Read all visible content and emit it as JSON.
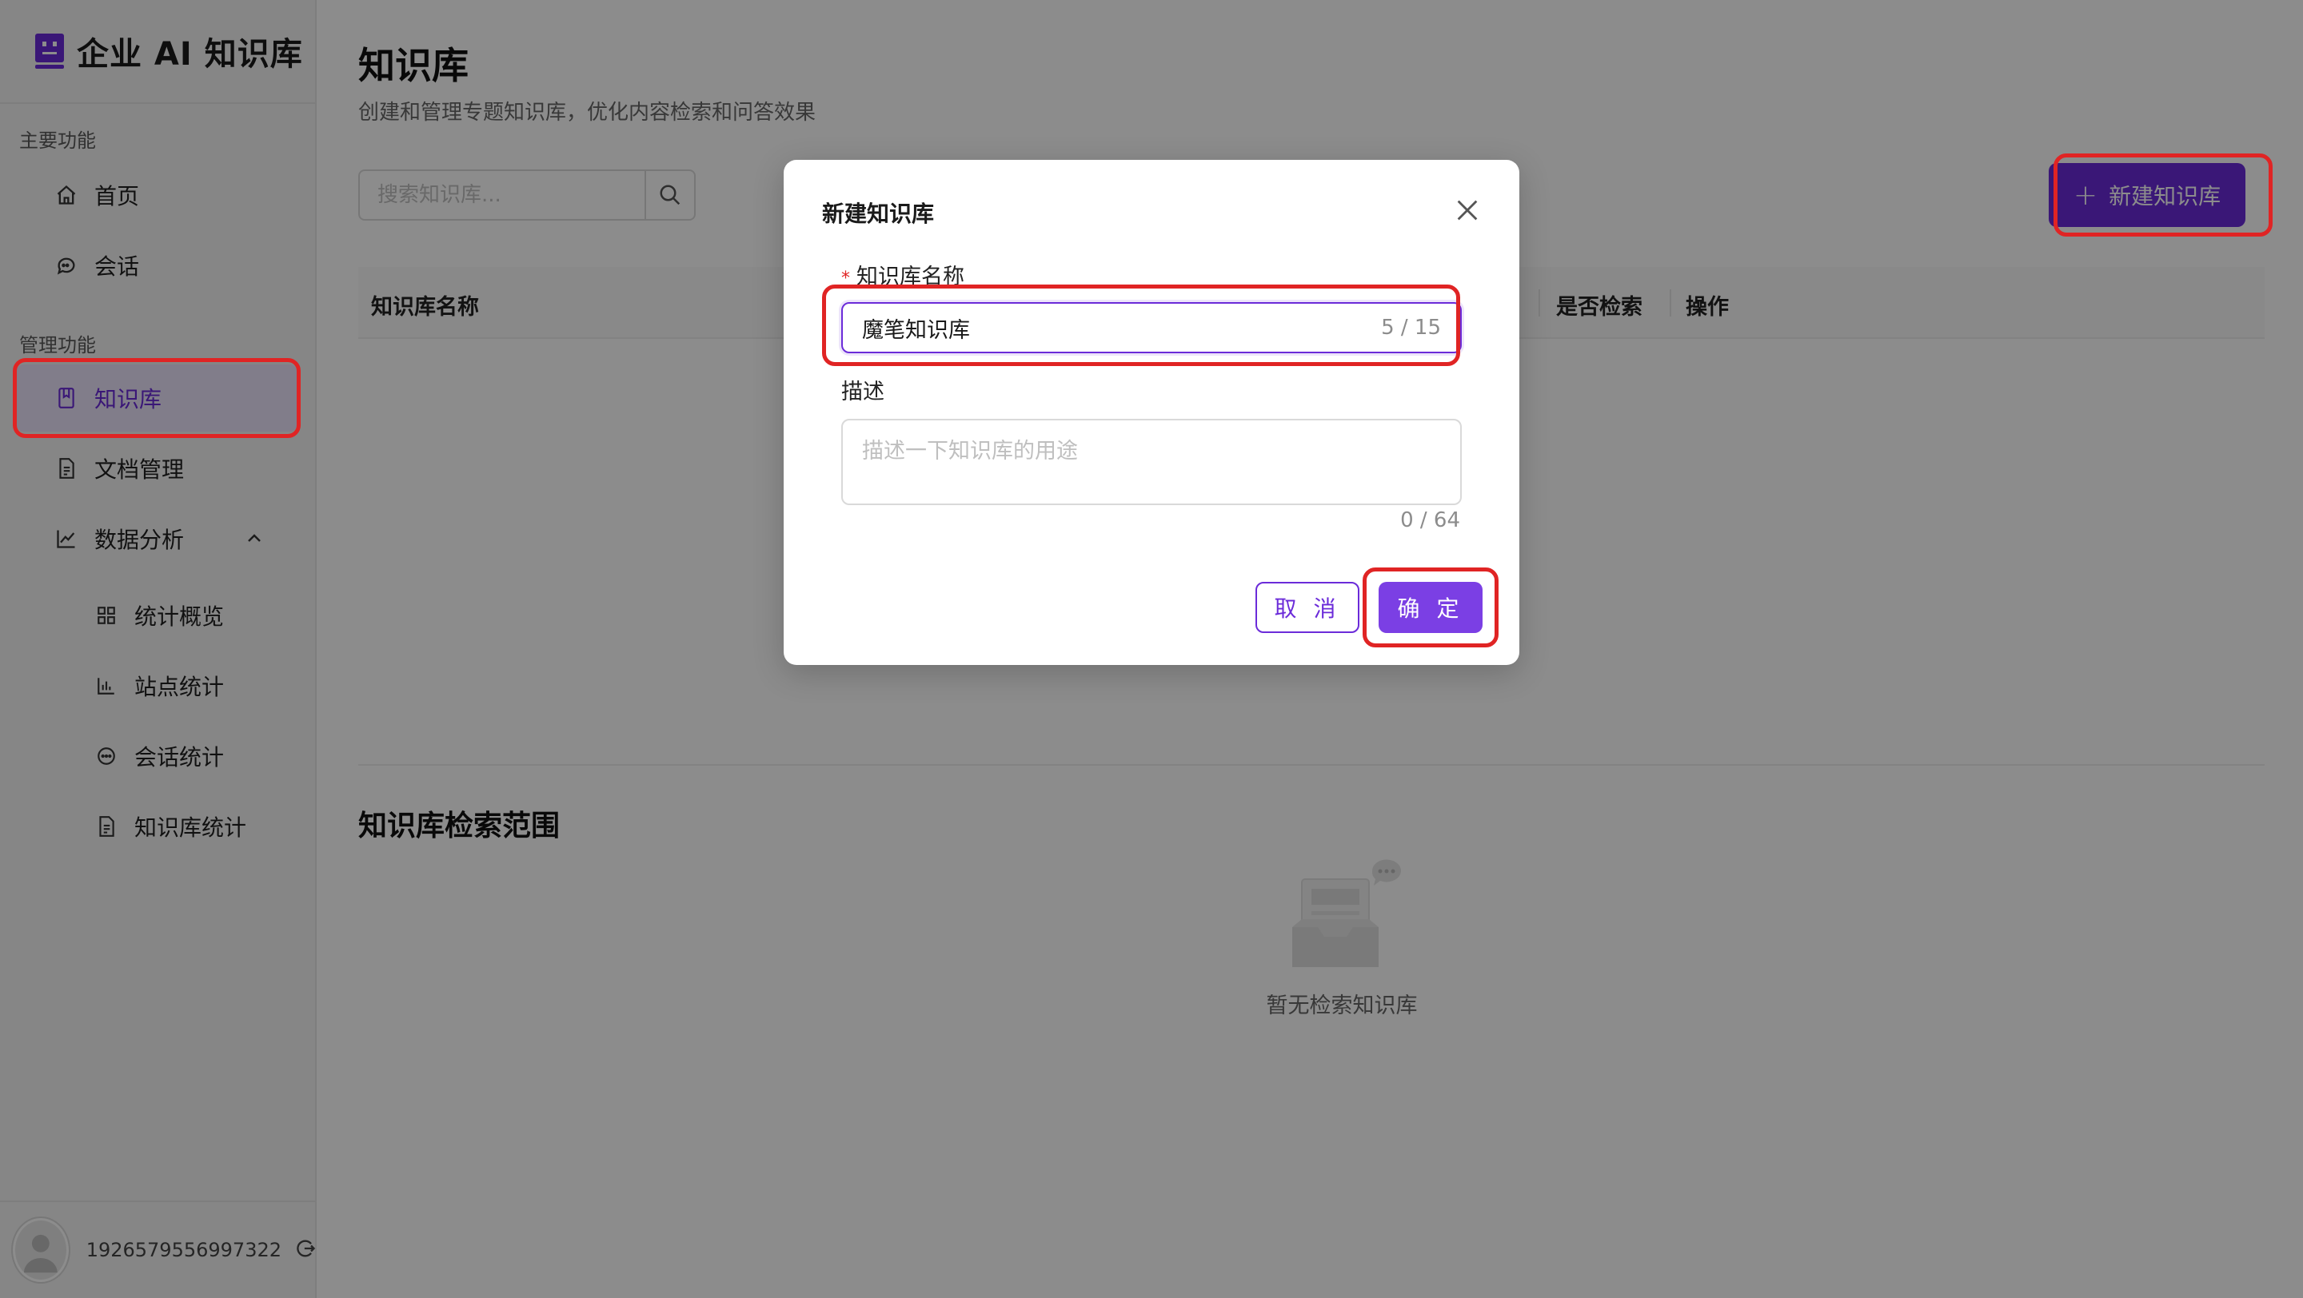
{
  "app": {
    "title": "企业 AI 知识库"
  },
  "sidebar": {
    "main_label": "主要功能",
    "admin_label": "管理功能",
    "items": [
      {
        "label": "首页",
        "icon": "home-icon"
      },
      {
        "label": "会话",
        "icon": "chat-icon"
      },
      {
        "label": "知识库",
        "icon": "book-icon",
        "active": true
      },
      {
        "label": "文档管理",
        "icon": "document-icon"
      },
      {
        "label": "数据分析",
        "icon": "line-chart-icon",
        "expanded": true
      }
    ],
    "sub_items": [
      {
        "label": "统计概览",
        "icon": "grid-icon"
      },
      {
        "label": "站点统计",
        "icon": "bar-chart-icon"
      },
      {
        "label": "会话统计",
        "icon": "message-dots-icon"
      },
      {
        "label": "知识库统计",
        "icon": "file-icon"
      }
    ]
  },
  "user": {
    "id": "1926579556997322"
  },
  "page": {
    "title": "知识库",
    "subtitle": "创建和管理专题知识库，优化内容检索和问答效果",
    "search_placeholder": "搜索知识库...",
    "new_button": "新建知识库",
    "table_headers": {
      "name": "知识库名称",
      "searchable": "是否检索",
      "actions": "操作"
    },
    "scope_title": "知识库检索范围",
    "empty_text": "暂无检索知识库"
  },
  "modal": {
    "title": "新建知识库",
    "name_label": "知识库名称",
    "name_value": "魔笔知识库",
    "name_count": "5 / 15",
    "desc_label": "描述",
    "desc_placeholder": "描述一下知识库的用途",
    "desc_count": "0 / 64",
    "cancel": "取 消",
    "ok": "确 定"
  },
  "colors": {
    "accent": "#6b2bd9",
    "highlight": "#e02424"
  }
}
